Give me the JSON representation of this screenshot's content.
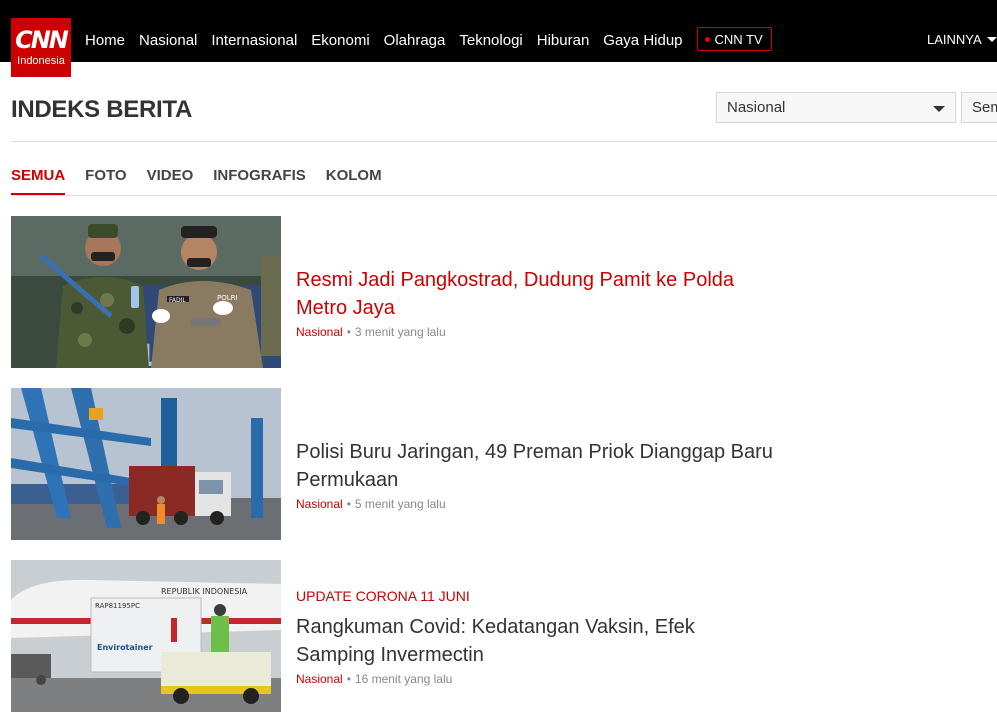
{
  "header": {
    "logo_main": "CNN",
    "logo_sub": "Indonesia",
    "nav": [
      "Home",
      "Nasional",
      "Internasional",
      "Ekonomi",
      "Olahraga",
      "Teknologi",
      "Hiburan",
      "Gaya Hidup"
    ],
    "tv_label": "CNN TV",
    "more_label": "LAINNYA"
  },
  "page": {
    "title": "INDEKS BERITA",
    "filter_category": "Nasional",
    "filter_second": "Sem"
  },
  "tabs": [
    "SEMUA",
    "FOTO",
    "VIDEO",
    "INFOGRAFIS",
    "KOLOM"
  ],
  "articles": [
    {
      "kicker": "",
      "title": "Resmi Jadi Pangkostrad, Dudung Pamit ke Polda Metro Jaya",
      "category": "Nasional",
      "time": "3 menit yang lalu"
    },
    {
      "kicker": "",
      "title": "Polisi Buru Jaringan, 49 Preman Priok Dianggap Baru Permukaan",
      "category": "Nasional",
      "time": "5 menit yang lalu"
    },
    {
      "kicker": "UPDATE CORONA 11 JUNI",
      "title": "Rangkuman Covid: Kedatangan Vaksin, Efek Samping Invermectin",
      "category": "Nasional",
      "time": "16 menit yang lalu"
    }
  ],
  "image_text": {
    "thumb1_label": "POLRI",
    "thumb1_name": "FADIL",
    "thumb3_plane": "REPUBLIK INDONESIA",
    "thumb3_box": "Envirotainer",
    "thumb3_code": "RAP81195PC"
  },
  "colors": {
    "brand": "#cc0000",
    "topbar": "#000000"
  }
}
